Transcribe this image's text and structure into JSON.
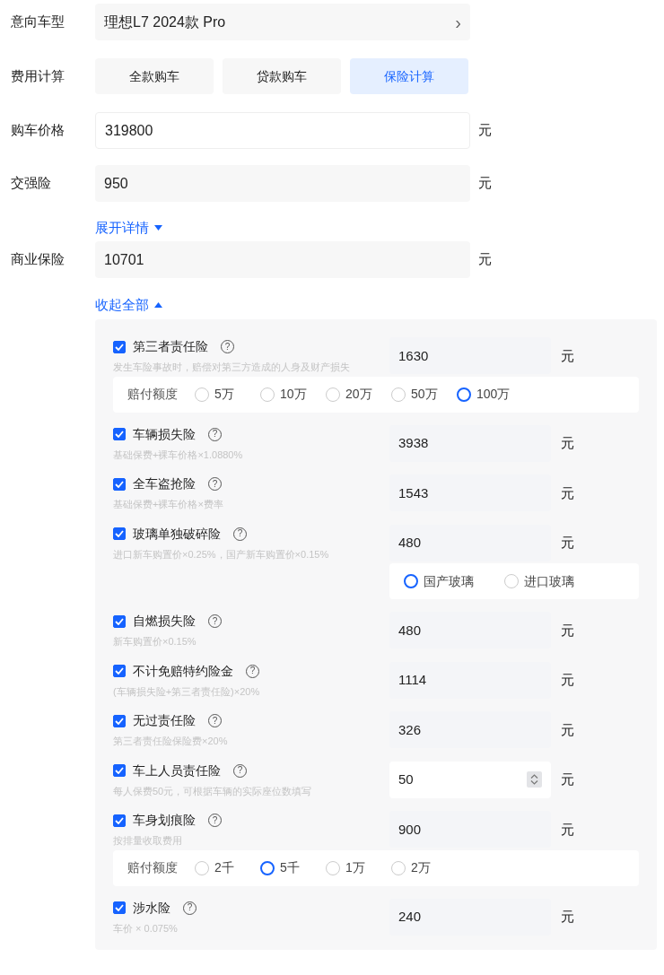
{
  "model": {
    "label": "意向车型",
    "value": "理想L7 2024款 Pro",
    "chevron": "›"
  },
  "calc": {
    "label": "费用计算",
    "tabs": [
      {
        "label": "全款购车",
        "selected": false
      },
      {
        "label": "贷款购车",
        "selected": false
      },
      {
        "label": "保险计算",
        "selected": true
      }
    ]
  },
  "price": {
    "label": "购车价格",
    "value": "319800",
    "unit": "元"
  },
  "compulsory": {
    "label": "交强险",
    "value": "950",
    "unit": "元"
  },
  "expand_link": {
    "text": "展开详情",
    "expanded": false
  },
  "commercial": {
    "label": "商业保险",
    "value": "10701",
    "unit": "元"
  },
  "collapse_link": {
    "text": "收起全部",
    "expanded": true
  },
  "items": [
    {
      "kind": "plain",
      "name": "第三者责任险",
      "help": "?",
      "checked": true,
      "desc": "发生车险事故时，赔偿对第三方造成的人身及财产损失",
      "value": "1630",
      "unit": "元",
      "options": {
        "label": "赔付额度",
        "choices": [
          {
            "text": "5万",
            "selected": false
          },
          {
            "text": "10万",
            "selected": false
          },
          {
            "text": "20万",
            "selected": false
          },
          {
            "text": "50万",
            "selected": false
          },
          {
            "text": "100万",
            "selected": true
          }
        ]
      }
    },
    {
      "kind": "plain",
      "name": "车辆损失险",
      "help": "?",
      "checked": true,
      "desc": "基础保费+裸车价格×1.0880%",
      "value": "3938",
      "unit": "元"
    },
    {
      "kind": "plain",
      "name": "全车盗抢险",
      "help": "?",
      "checked": true,
      "desc": "基础保费+裸车价格×费率",
      "value": "1543",
      "unit": "元"
    },
    {
      "kind": "plain",
      "name": "玻璃单独破碎险",
      "help": "?",
      "checked": true,
      "desc": "进口新车购置价×0.25%，国产新车购置价×0.15%",
      "value": "480",
      "unit": "元",
      "options": {
        "choices": [
          {
            "text": "国产玻璃",
            "selected": true
          },
          {
            "text": "进口玻璃",
            "selected": false
          }
        ]
      }
    },
    {
      "kind": "plain",
      "name": "自燃损失险",
      "help": "?",
      "checked": true,
      "desc": "新车购置价×0.15%",
      "value": "480",
      "unit": "元"
    },
    {
      "kind": "plain",
      "name": "不计免赔特约险金",
      "help": "?",
      "checked": true,
      "desc": "(车辆损失险+第三者责任险)×20%",
      "value": "1114",
      "unit": "元"
    },
    {
      "kind": "plain",
      "name": "无过责任险",
      "help": "?",
      "checked": true,
      "desc": "第三者责任险保险费×20%",
      "value": "326",
      "unit": "元"
    },
    {
      "kind": "number",
      "name": "车上人员责任险",
      "help": "?",
      "checked": true,
      "desc": "每人保费50元，可根据车辆的实际座位数填写",
      "value": "50",
      "unit": "元"
    },
    {
      "kind": "plain",
      "name": "车身划痕险",
      "help": "?",
      "checked": true,
      "desc": "按排量收取费用",
      "value": "900",
      "unit": "元",
      "options": {
        "label": "赔付额度",
        "choices": [
          {
            "text": "2千",
            "selected": false
          },
          {
            "text": "5千",
            "selected": true
          },
          {
            "text": "1万",
            "selected": false
          },
          {
            "text": "2万",
            "selected": false
          }
        ]
      }
    },
    {
      "kind": "plain",
      "name": "涉水险",
      "help": "?",
      "checked": true,
      "desc": "车价 × 0.075%",
      "value": "240",
      "unit": "元"
    }
  ]
}
